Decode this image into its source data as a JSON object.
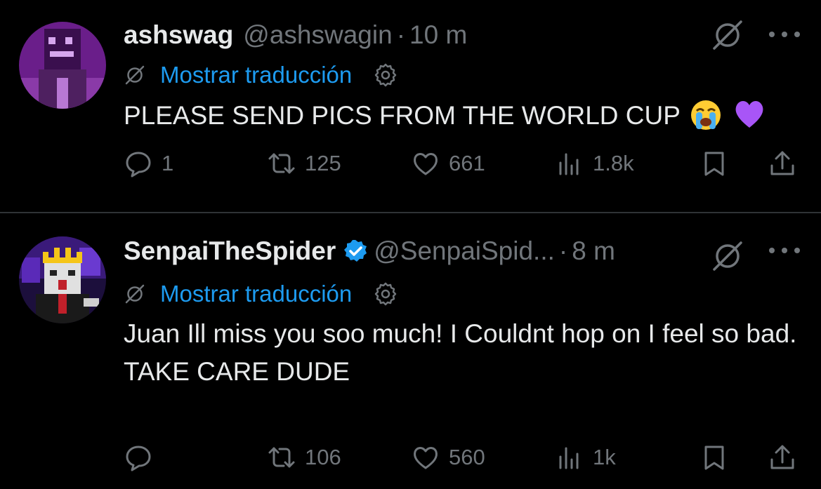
{
  "translate_label": "Mostrar traducción",
  "colors": {
    "background": "#000000",
    "text": "#e7e9ea",
    "muted": "#71767b",
    "link": "#1d9bf0",
    "divider": "#2f3336"
  },
  "tweets": [
    {
      "name": "ashswag",
      "verified": false,
      "handle": "@ashswagin",
      "dot": "·",
      "time": "10 m",
      "text": "PLEASE SEND PICS FROM THE WORLD CUP",
      "emojis": [
        "loudly-crying-face-emoji",
        "purple-heart-emoji"
      ],
      "stats": {
        "replies": "1",
        "retweets": "125",
        "likes": "661",
        "views": "1.8k"
      }
    },
    {
      "name": "SenpaiTheSpider",
      "verified": true,
      "handle": "@SenpaiSpid...",
      "dot": "·",
      "time": "8 m",
      "text_lines": [
        "Juan Ill miss you soo much! I Couldnt hop on I feel so bad.",
        "TAKE CARE DUDE"
      ],
      "stats": {
        "replies": "",
        "retweets": "106",
        "likes": "560",
        "views": "1k"
      }
    }
  ]
}
